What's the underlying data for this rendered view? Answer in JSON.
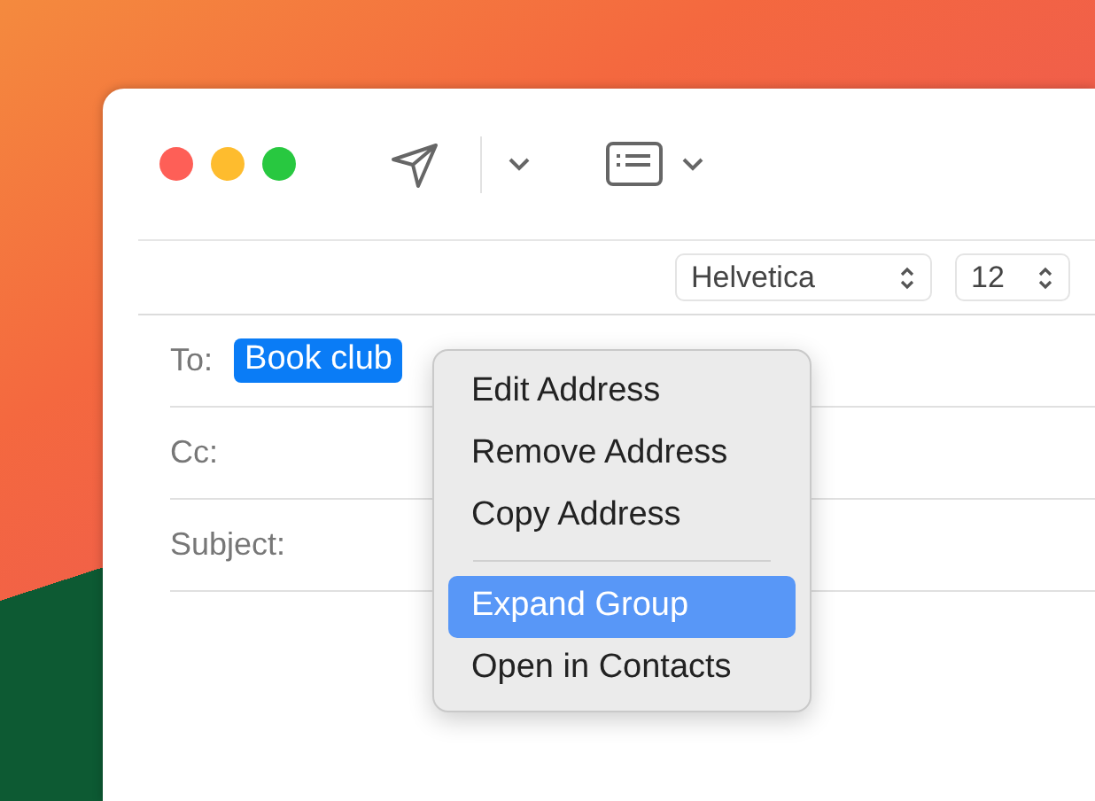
{
  "format_bar": {
    "font": "Helvetica",
    "size": "12"
  },
  "fields": [
    {
      "label": "To:",
      "tokens": [
        {
          "text": "Book club",
          "selected": true
        }
      ]
    },
    {
      "label": "Cc:"
    },
    {
      "label": "Subject:"
    }
  ],
  "context_menu": {
    "items": [
      {
        "kind": "item",
        "label": "Edit Address",
        "selected": false
      },
      {
        "kind": "item",
        "label": "Remove Address",
        "selected": false
      },
      {
        "kind": "item",
        "label": "Copy Address",
        "selected": false
      },
      {
        "kind": "separator"
      },
      {
        "kind": "item",
        "label": "Expand Group",
        "selected": true
      },
      {
        "kind": "item",
        "label": "Open in Contacts",
        "selected": false
      }
    ]
  }
}
